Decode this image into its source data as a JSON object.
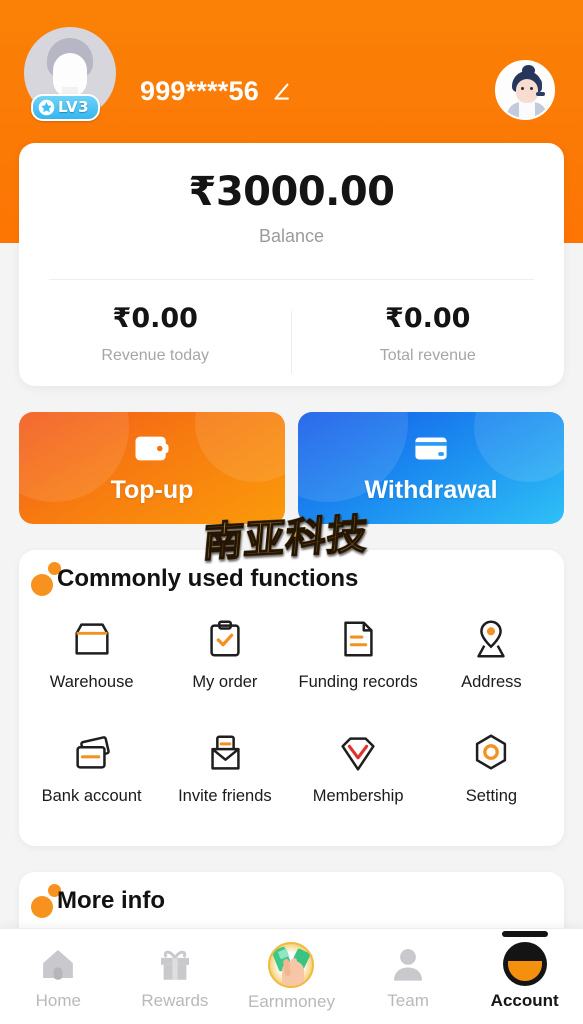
{
  "header": {
    "username": "999****56",
    "level_badge": "LV3",
    "level_star_icon": "star-icon",
    "edit_icon": "edit-pencil-icon",
    "user_avatar_icon": "user-avatar",
    "support_avatar_icon": "customer-service-avatar",
    "bg_color": "#FA7F06"
  },
  "balance_card": {
    "amount": "₹3000.00",
    "amount_label": "Balance",
    "stats": [
      {
        "value": "₹0.00",
        "label": "Revenue today"
      },
      {
        "value": "₹0.00",
        "label": "Total revenue"
      }
    ]
  },
  "actions": [
    {
      "label": "Top-up",
      "icon": "wallet-icon",
      "color_from": "#F2581B",
      "color_to": "#FB9A0A"
    },
    {
      "label": "Withdrawal",
      "icon": "credit-card-icon",
      "color_from": "#1559E8",
      "color_to": "#2FC0F6"
    }
  ],
  "watermark": {
    "text": "南亚科技"
  },
  "functions_section": {
    "title": "Commonly used functions",
    "items": [
      {
        "label": "Warehouse",
        "icon": "box-icon"
      },
      {
        "label": "My order",
        "icon": "clipboard-check-icon"
      },
      {
        "label": "Funding records",
        "icon": "document-lines-icon"
      },
      {
        "label": "Address",
        "icon": "location-pin-icon"
      },
      {
        "label": "Bank account",
        "icon": "bank-card-icon"
      },
      {
        "label": "Invite friends",
        "icon": "envelope-icon"
      },
      {
        "label": "Membership",
        "icon": "diamond-icon"
      },
      {
        "label": "Setting",
        "icon": "hex-gear-icon"
      }
    ]
  },
  "more_section": {
    "title": "More info"
  },
  "bottom_nav": {
    "items": [
      {
        "label": "Home",
        "icon": "home-icon",
        "active": false
      },
      {
        "label": "Rewards",
        "icon": "gift-icon",
        "active": false
      },
      {
        "label": "Earnmoney",
        "icon": "money-hand-icon",
        "active": false
      },
      {
        "label": "Team",
        "icon": "person-icon",
        "active": false
      },
      {
        "label": "Account",
        "icon": "account-icon",
        "active": true
      }
    ]
  },
  "theme": {
    "accent": "#F7921E",
    "header_orange": "#FA7F06",
    "blue": "#1B8BF0",
    "text_dark": "#141414",
    "text_muted": "#9B9B9F"
  }
}
